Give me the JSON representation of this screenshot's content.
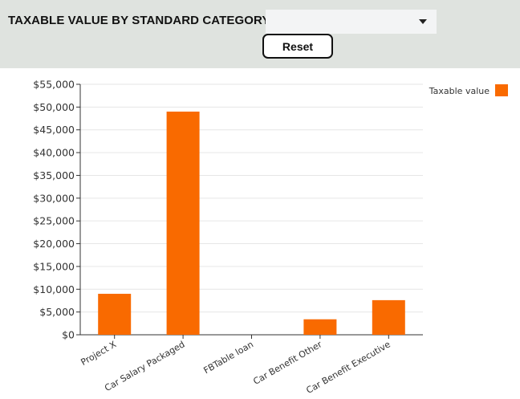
{
  "header": {
    "title": "TAXABLE VALUE BY STANDARD CATEGORY",
    "select_value": "",
    "reset_label": "Reset"
  },
  "colors": {
    "bar": "#f96a00",
    "header_bg": "#dfe3df"
  },
  "chart_data": {
    "type": "bar",
    "categories": [
      "Project X",
      "Car Salary Packaged",
      "FBTable loan",
      "Car Benefit Other",
      "Car Benefit Executive"
    ],
    "series": [
      {
        "name": "Taxable value",
        "values": [
          9000,
          49000,
          0,
          3400,
          7600
        ]
      }
    ],
    "ylim": [
      0,
      55000
    ],
    "yticks": [
      0,
      5000,
      10000,
      15000,
      20000,
      25000,
      30000,
      35000,
      40000,
      45000,
      50000,
      55000
    ],
    "ytick_labels": [
      "$0",
      "$5,000",
      "$10,000",
      "$15,000",
      "$20,000",
      "$25,000",
      "$30,000",
      "$35,000",
      "$40,000",
      "$45,000",
      "$50,000",
      "$55,000"
    ],
    "grid": true,
    "legend": "top-right"
  }
}
